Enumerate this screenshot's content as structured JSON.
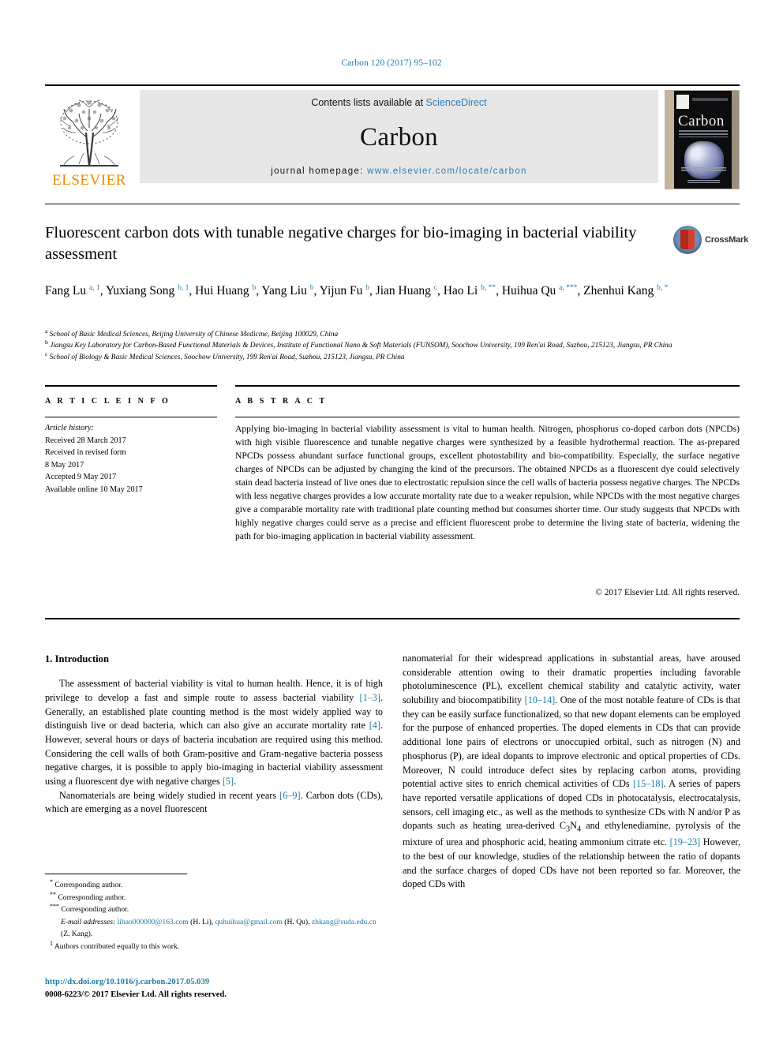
{
  "running_head": "Carbon 120 (2017) 95–102",
  "masthead": {
    "publisher": "ELSEVIER",
    "contents_prefix": "Contents lists available at ",
    "contents_link": "ScienceDirect",
    "journal_title": "Carbon",
    "homepage_label": "journal homepage: ",
    "homepage_url": "www.elsevier.com/locate/carbon",
    "cover_title": "Carbon"
  },
  "article": {
    "title": "Fluorescent carbon dots with tunable negative charges for bio-imaging in bacterial viability assessment",
    "crossmark_label": "CrossMark",
    "authors_html": "Fang Lu <sup>a, 1</sup>, Yuxiang Song <sup>b, 1</sup>, Hui Huang <sup>b</sup>, Yang Liu <sup>b</sup>, Yijun Fu <sup>b</sup>, Jian Huang <sup>c</sup>, Hao Li <sup>b, **</sup>, Huihua Qu <sup>a, ***</sup>, Zhenhui Kang <sup>b, *</sup>",
    "affiliations": [
      {
        "marker": "a",
        "text": "School of Basic Medical Sciences, Beijing University of Chinese Medicine, Beijing 100029, China"
      },
      {
        "marker": "b",
        "text": "Jiangsu Key Laboratory for Carbon-Based Functional Materials & Devices, Institute of Functional Nano & Soft Materials (FUNSOM), Soochow University, 199 Ren'ai Road, Suzhou, 215123, Jiangsu, PR China"
      },
      {
        "marker": "c",
        "text": "School of Biology & Basic Medical Sciences, Soochow University, 199 Ren'ai Road, Suzhou, 215123, Jiangsu, PR China"
      }
    ]
  },
  "info": {
    "header": "A R T I C L E   I N F O",
    "history_title": "Article history:",
    "history": [
      "Received 28 March 2017",
      "Received in revised form",
      "8 May 2017",
      "Accepted 9 May 2017",
      "Available online 10 May 2017"
    ]
  },
  "abstract": {
    "header": "A B S T R A C T",
    "text": "Applying bio-imaging in bacterial viability assessment is vital to human health. Nitrogen, phosphorus co-doped carbon dots (NPCDs) with high visible fluorescence and tunable negative charges were synthesized by a feasible hydrothermal reaction. The as-prepared NPCDs possess abundant surface functional groups, excellent photostability and bio-compatibility. Especially, the surface negative charges of NPCDs can be adjusted by changing the kind of the precursors. The obtained NPCDs as a fluorescent dye could selectively stain dead bacteria instead of live ones due to electrostatic repulsion since the cell walls of bacteria possess negative charges. The NPCDs with less negative charges provides a low accurate mortality rate due to a weaker repulsion, while NPCDs with the most negative charges give a comparable mortality rate with traditional plate counting method but consumes shorter time. Our study suggests that NPCDs with highly negative charges could serve as a precise and efficient fluorescent probe to determine the living state of bacteria, widening the path for bio-imaging application in bacterial viability assessment.",
    "copyright": "© 2017 Elsevier Ltd. All rights reserved."
  },
  "body": {
    "section_heading": "1. Introduction",
    "left_paragraphs_html": [
      "The assessment of bacterial viability is vital to human health. Hence, it is of high privilege to develop a fast and simple route to assess bacterial viability <span class=\"ref\">[1–3]</span>. Generally, an established plate counting method is the most widely applied way to distinguish live or dead bacteria, which can also give an accurate mortality rate <span class=\"ref\">[4]</span>. However, several hours or days of bacteria incubation are required using this method. Considering the cell walls of both Gram-positive and Gram-negative bacteria possess negative charges, it is possible to apply bio-imaging in bacterial viability assessment using a fluorescent dye with negative charges <span class=\"ref\">[5]</span>.",
      "Nanomaterials are being widely studied in recent years <span class=\"ref\">[6–9]</span>. Carbon dots (CDs), which are emerging as a novel fluorescent"
    ],
    "right_paragraphs_html": [
      "nanomaterial for their widespread applications in substantial areas, have aroused considerable attention owing to their dramatic properties including favorable photoluminescence (PL), excellent chemical stability and catalytic activity, water solubility and biocompatibility <span class=\"ref\">[10–14]</span>. One of the most notable feature of CDs is that they can be easily surface functionalized, so that new dopant elements can be employed for the purpose of enhanced properties. The doped elements in CDs that can provide additional lone pairs of electrons or unoccupied orbital, such as nitrogen (N) and phosphorus (P), are ideal dopants to improve electronic and optical properties of CDs. Moreover, N could introduce defect sites by replacing carbon atoms, providing potential active sites to enrich chemical activities of CDs <span class=\"ref\">[15–18]</span>. A series of papers have reported versatile applications of doped CDs in photocatalysis, electrocatalysis, sensors, cell imaging etc., as well as the methods to synthesize CDs with N and/or P as dopants such as heating urea-derived C<sub>3</sub>N<sub>4</sub> and ethylenediamine, pyrolysis of the mixture of urea and phosphoric acid, heating ammonium citrate etc. <span class=\"ref\">[19–23]</span> However, to the best of our knowledge, studies of the relationship between the ratio of dopants and the surface charges of doped CDs have not been reported so far. Moreover, the doped CDs with"
    ]
  },
  "footnotes": {
    "corresponding": [
      {
        "marker": "*",
        "text": "Corresponding author."
      },
      {
        "marker": "**",
        "text": "Corresponding author."
      },
      {
        "marker": "***",
        "text": "Corresponding author."
      }
    ],
    "email_label": "E-mail addresses:",
    "emails": [
      {
        "address": "lihao000000@163.com",
        "owner": "(H. Li)"
      },
      {
        "address": "quhuihua@gmail.com",
        "owner": "(H. Qu)"
      },
      {
        "address": "zhkang@suda.edu.cn",
        "owner": "(Z. Kang)."
      }
    ],
    "equal_contribution": {
      "marker": "1",
      "text": "Authors contributed equally to this work."
    }
  },
  "doi": {
    "url": "http://dx.doi.org/10.1016/j.carbon.2017.05.039",
    "issn_line": "0008-6223/© 2017 Elsevier Ltd. All rights reserved."
  },
  "colors": {
    "link_blue": "#1f7ba8",
    "elsevier_orange": "#ED8B00",
    "banner_gray": "#e7e7e7"
  }
}
